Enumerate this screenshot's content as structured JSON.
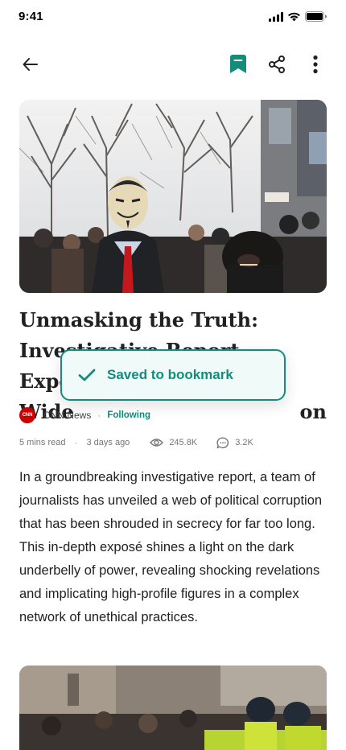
{
  "status_bar": {
    "time": "9:41"
  },
  "top_bar": {
    "back_icon": "arrow-left-icon",
    "bookmark_icon": "bookmark-filled-icon",
    "share_icon": "share-icon",
    "more_icon": "more-vertical-icon",
    "accent": "#138c7c"
  },
  "article": {
    "title_lines": [
      "Unmasking the Truth:",
      "Investigative Report Exposes",
      "Wide",
      "on"
    ],
    "source": {
      "logo_text": "CNN",
      "name": "CNN News",
      "separator": "·",
      "following": "Following"
    },
    "meta": {
      "read_time": "5 mins read",
      "separator": "·",
      "published": "3 days ago",
      "views": "245.8K",
      "comments": "3.2K"
    },
    "body": "In a groundbreaking investigative report, a team of journalists has unveiled a web of political corruption that has been shrouded in secrecy for far too long. This in-depth exposé shines a light on the dark underbelly of power, revealing shocking revelations and implicating high-profile figures in a complex network of unethical practices."
  },
  "toast": {
    "message": "Saved to bookmark",
    "icon": "check-icon"
  }
}
